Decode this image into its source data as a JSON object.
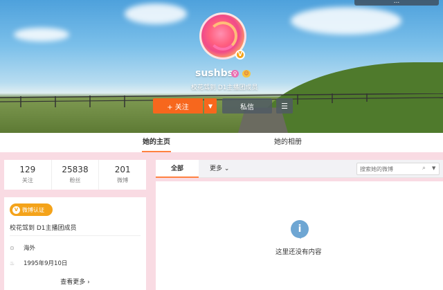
{
  "header": {
    "topbar_text": "...",
    "username": "sushbs",
    "bio": "校花驾到  D1主播团成员",
    "follow_label": "+ 关注",
    "message_label": "私信"
  },
  "tabs": [
    {
      "label": "她的主页",
      "active": true
    },
    {
      "label": "她的相册",
      "active": false
    }
  ],
  "stats": [
    {
      "value": "129",
      "label": "关注"
    },
    {
      "value": "25838",
      "label": "粉丝"
    },
    {
      "value": "201",
      "label": "微博"
    }
  ],
  "profile": {
    "verify_label": "微博认证",
    "verify_text": "校花驾到  D1主播团成员",
    "location": "海外",
    "birthday": "1995年9月10日",
    "more_label": "查看更多 ›"
  },
  "feed": {
    "tab_all": "全部",
    "tab_more": "更多",
    "search_placeholder": "搜索她的微博",
    "empty_text": "这里还没有内容"
  },
  "colors": {
    "accent": "#f7671d",
    "verify": "#f4a31a",
    "page_bg": "#f9dbe3"
  }
}
